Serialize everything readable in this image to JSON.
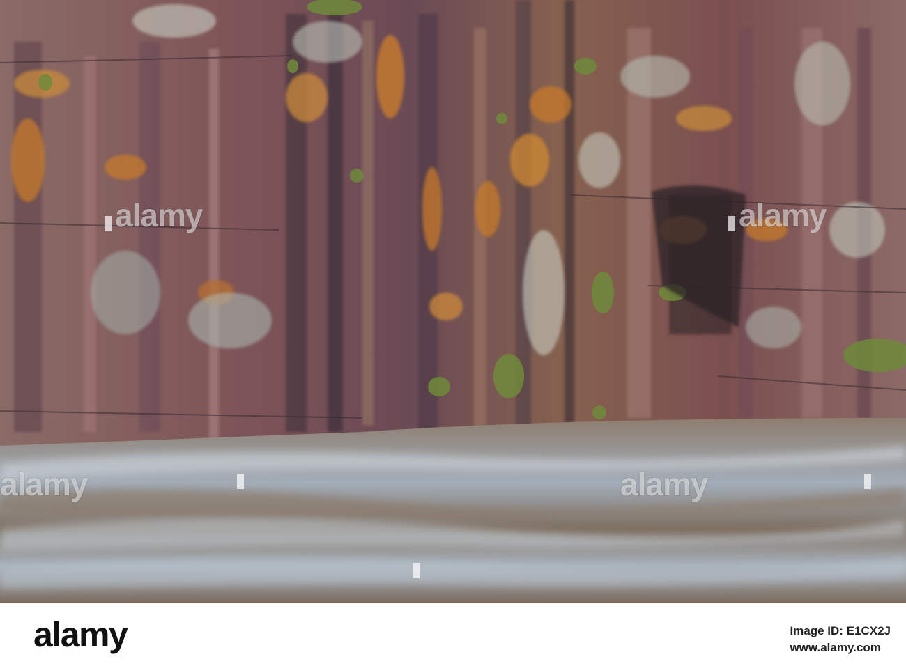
{
  "image": {
    "description_free": true,
    "watermark_text": "alamy",
    "colors": {
      "rock_red": "#8a4e53",
      "rock_dark": "#3a2f3a",
      "lichen_orange": "#c77a2a",
      "lichen_pale": "#b9c1b0",
      "water_brown": "#7d6a58",
      "water_blue": "#9fb0c0",
      "moss_green": "#6f8a3a"
    }
  },
  "footer": {
    "brand": "alamy",
    "image_id": "Image ID: E1CX2J",
    "site": "www.alamy.com"
  }
}
